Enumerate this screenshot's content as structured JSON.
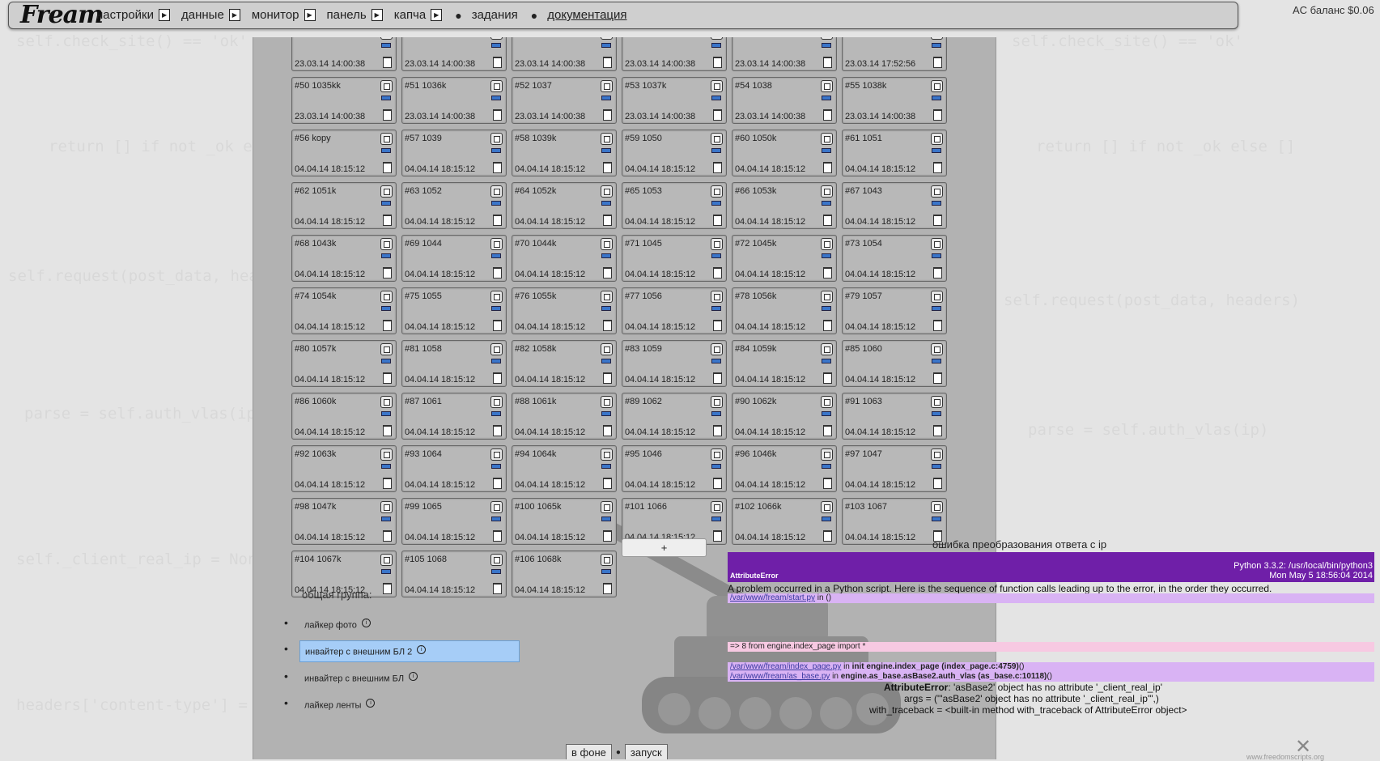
{
  "logo": "Fream",
  "menu": {
    "items": [
      "настройки",
      "данные",
      "монитор",
      "панель",
      "капча"
    ],
    "tasks": "задания",
    "docs": "документация"
  },
  "balance": "AC баланс $0.06",
  "cards": [
    {
      "label": "",
      "date": "23.03.14 14:00:38"
    },
    {
      "label": "",
      "date": "23.03.14 14:00:38"
    },
    {
      "label": "",
      "date": "23.03.14 14:00:38"
    },
    {
      "label": "",
      "date": "23.03.14 14:00:38"
    },
    {
      "label": "",
      "date": "23.03.14 14:00:38"
    },
    {
      "label": "",
      "date": "23.03.14 17:52:56"
    },
    {
      "label": "#50 1035kk",
      "date": "23.03.14 14:00:38"
    },
    {
      "label": "#51 1036k",
      "date": "23.03.14 14:00:38"
    },
    {
      "label": "#52 1037",
      "date": "23.03.14 14:00:38"
    },
    {
      "label": "#53 1037k",
      "date": "23.03.14 14:00:38"
    },
    {
      "label": "#54 1038",
      "date": "23.03.14 14:00:38"
    },
    {
      "label": "#55 1038k",
      "date": "23.03.14 14:00:38"
    },
    {
      "label": "#56 kopy",
      "date": "04.04.14 18:15:12"
    },
    {
      "label": "#57 1039",
      "date": "04.04.14 18:15:12"
    },
    {
      "label": "#58 1039k",
      "date": "04.04.14 18:15:12"
    },
    {
      "label": "#59 1050",
      "date": "04.04.14 18:15:12"
    },
    {
      "label": "#60 1050k",
      "date": "04.04.14 18:15:12"
    },
    {
      "label": "#61 1051",
      "date": "04.04.14 18:15:12"
    },
    {
      "label": "#62 1051k",
      "date": "04.04.14 18:15:12"
    },
    {
      "label": "#63 1052",
      "date": "04.04.14 18:15:12"
    },
    {
      "label": "#64 1052k",
      "date": "04.04.14 18:15:12"
    },
    {
      "label": "#65 1053",
      "date": "04.04.14 18:15:12"
    },
    {
      "label": "#66 1053k",
      "date": "04.04.14 18:15:12"
    },
    {
      "label": "#67 1043",
      "date": "04.04.14 18:15:12"
    },
    {
      "label": "#68 1043k",
      "date": "04.04.14 18:15:12"
    },
    {
      "label": "#69 1044",
      "date": "04.04.14 18:15:12"
    },
    {
      "label": "#70 1044k",
      "date": "04.04.14 18:15:12"
    },
    {
      "label": "#71 1045",
      "date": "04.04.14 18:15:12"
    },
    {
      "label": "#72 1045k",
      "date": "04.04.14 18:15:12"
    },
    {
      "label": "#73 1054",
      "date": "04.04.14 18:15:12"
    },
    {
      "label": "#74 1054k",
      "date": "04.04.14 18:15:12"
    },
    {
      "label": "#75 1055",
      "date": "04.04.14 18:15:12"
    },
    {
      "label": "#76 1055k",
      "date": "04.04.14 18:15:12"
    },
    {
      "label": "#77 1056",
      "date": "04.04.14 18:15:12"
    },
    {
      "label": "#78 1056k",
      "date": "04.04.14 18:15:12"
    },
    {
      "label": "#79 1057",
      "date": "04.04.14 18:15:12"
    },
    {
      "label": "#80 1057k",
      "date": "04.04.14 18:15:12"
    },
    {
      "label": "#81 1058",
      "date": "04.04.14 18:15:12"
    },
    {
      "label": "#82 1058k",
      "date": "04.04.14 18:15:12"
    },
    {
      "label": "#83 1059",
      "date": "04.04.14 18:15:12"
    },
    {
      "label": "#84 1059k",
      "date": "04.04.14 18:15:12"
    },
    {
      "label": "#85 1060",
      "date": "04.04.14 18:15:12"
    },
    {
      "label": "#86 1060k",
      "date": "04.04.14 18:15:12"
    },
    {
      "label": "#87 1061",
      "date": "04.04.14 18:15:12"
    },
    {
      "label": "#88 1061k",
      "date": "04.04.14 18:15:12"
    },
    {
      "label": "#89 1062",
      "date": "04.04.14 18:15:12"
    },
    {
      "label": "#90 1062k",
      "date": "04.04.14 18:15:12"
    },
    {
      "label": "#91 1063",
      "date": "04.04.14 18:15:12"
    },
    {
      "label": "#92 1063k",
      "date": "04.04.14 18:15:12"
    },
    {
      "label": "#93 1064",
      "date": "04.04.14 18:15:12"
    },
    {
      "label": "#94 1064k",
      "date": "04.04.14 18:15:12"
    },
    {
      "label": "#95 1046",
      "date": "04.04.14 18:15:12"
    },
    {
      "label": "#96 1046k",
      "date": "04.04.14 18:15:12"
    },
    {
      "label": "#97 1047",
      "date": "04.04.14 18:15:12"
    },
    {
      "label": "#98 1047k",
      "date": "04.04.14 18:15:12"
    },
    {
      "label": "#99 1065",
      "date": "04.04.14 18:15:12"
    },
    {
      "label": "#100 1065k",
      "date": "04.04.14 18:15:12"
    },
    {
      "label": "#101 1066",
      "date": "04.04.14 18:15:12"
    },
    {
      "label": "#102 1066k",
      "date": "04.04.14 18:15:12"
    },
    {
      "label": "#103 1067",
      "date": "04.04.14 18:15:12"
    },
    {
      "label": "#104 1067k",
      "date": "04.04.14 18:15:12"
    },
    {
      "label": "#105 1068",
      "date": "04.04.14 18:15:12"
    },
    {
      "label": "#106 1068k",
      "date": "04.04.14 18:15:12"
    }
  ],
  "add_button": "+",
  "group": {
    "header": "общая группа:",
    "items": [
      {
        "label": "лайкер фото",
        "selected": false
      },
      {
        "label": "инвайтер с внешним БЛ 2",
        "selected": true
      },
      {
        "label": "инвайтер с внешним БЛ",
        "selected": false
      },
      {
        "label": "лайкер ленты",
        "selected": false
      }
    ],
    "info_glyph": "i"
  },
  "buttons": {
    "background": "в фоне",
    "run": "запуск"
  },
  "error": {
    "title": "ошибка преобразования ответа с ip",
    "type": "AttributeError",
    "version": "Python 3.3.2: /usr/local/bin/python3",
    "date": "Mon May 5 18:56:04 2014",
    "message": "A problem occurred in a Python script. Here is the sequence of function calls leading up to the error, in the order they occurred.",
    "frame1_path": "/var/www/fream/start.py",
    "frame1_rest": " in ()",
    "frame2_code": "=>   8 from engine.index_page import *",
    "frame3_path": "/var/www/fream/index_page.py",
    "frame3_mid": " in ",
    "frame3_func": "init engine.index_page (index_page.c:4759)",
    "frame3_tail": "()",
    "frame4_path": "/var/www/fream/as_base.py",
    "frame4_mid": " in ",
    "frame4_func": "engine.as_base.asBase2.auth_vlas (as_base.c:10118)",
    "frame4_tail": "()",
    "exc_name": "AttributeError",
    "exc_msg": ": 'asBase2' object has no attribute '_client_real_ip'",
    "args_line": "args = (\"'asBase2' object has no attribute '_client_real_ip'\",)",
    "traceback_line": "with_traceback = <built-in method with_traceback of AttributeError object>"
  },
  "watermark": "www.freedomscripts.org",
  "colors": {
    "error_header": "#6f1fa8",
    "frame_bg": "#d9b3f4",
    "frame_highlight": "#f7c9e2",
    "selected_item": "#a6cdf7"
  }
}
